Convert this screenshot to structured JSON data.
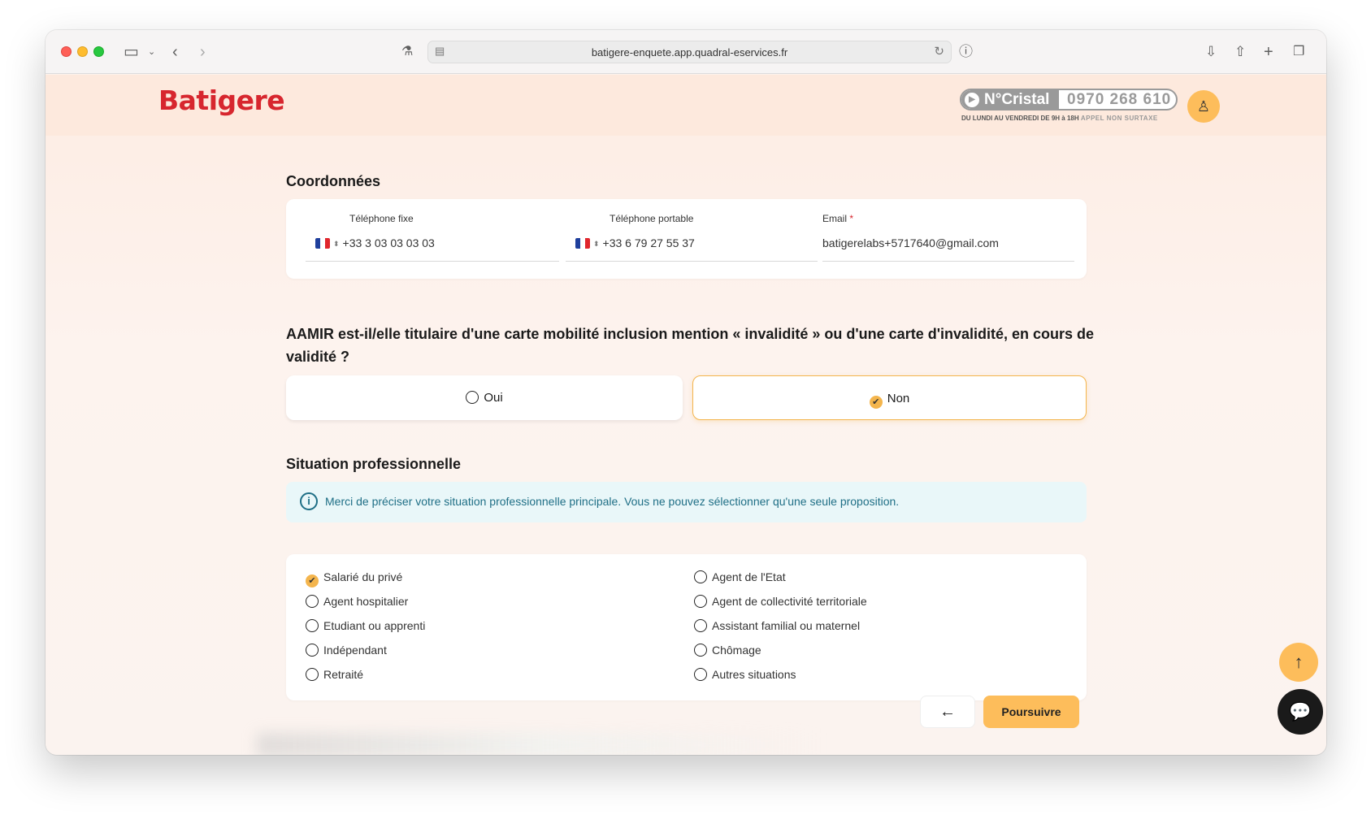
{
  "browser": {
    "url": "batigere-enquete.app.quadral-eservices.fr"
  },
  "header": {
    "logo_text": "Batigere",
    "cristal_label": "N°Cristal",
    "cristal_number": "0970 268 610",
    "cristal_hours": "DU LUNDI AU VENDREDI DE 9H à 18H",
    "cristal_note": "APPEL NON SURTAXE"
  },
  "coordonnees": {
    "title": "Coordonnées",
    "fixe_label": "Téléphone fixe",
    "fixe_value": "+33 3 03 03 03 03",
    "portable_label": "Téléphone portable",
    "portable_value": "+33 6 79 27 55 37",
    "email_label": "Email",
    "email_required": "*",
    "email_value": "batigerelabs+5717640@gmail.com"
  },
  "question": {
    "text": "AAMIR est-il/elle titulaire d'une carte mobilité inclusion mention « invalidité » ou d'une carte d'invalidité, en cours de validité ?",
    "option_yes": "Oui",
    "option_no": "Non",
    "selected": "Non"
  },
  "situation": {
    "title": "Situation professionnelle",
    "info": "Merci de préciser votre situation professionnelle principale. Vous ne pouvez sélectionner qu'une seule proposition.",
    "selected": "Salarié du privé",
    "left_options": [
      "Salarié du privé",
      "Agent hospitalier",
      "Etudiant ou apprenti",
      "Indépendant",
      "Retraité"
    ],
    "right_options": [
      "Agent de l'Etat",
      "Agent de collectivité territoriale",
      "Assistant familial ou maternel",
      "Chômage",
      "Autres situations"
    ]
  },
  "footer": {
    "next_label": "Poursuivre"
  },
  "colors": {
    "accent": "#fdbd5b",
    "brand_red": "#d7262e",
    "info_text": "#1f6f86"
  }
}
